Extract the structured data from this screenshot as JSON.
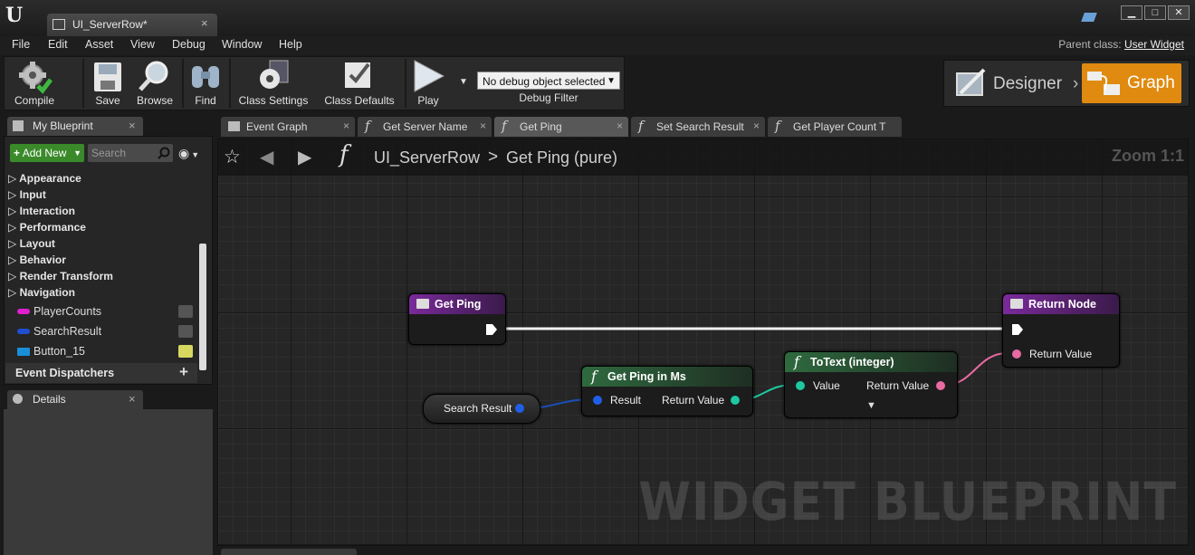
{
  "titlebar": {
    "doc_tab_label": "UI_ServerRow*",
    "doc_tab_close": "×",
    "win_min": "▁",
    "win_max": "□",
    "win_close": "✕"
  },
  "menu": {
    "items": [
      "File",
      "Edit",
      "Asset",
      "View",
      "Debug",
      "Window",
      "Help"
    ],
    "parent_class_label": "Parent class:",
    "parent_class_value": "User Widget"
  },
  "toolbar": {
    "compile": "Compile",
    "save": "Save",
    "browse": "Browse",
    "find": "Find",
    "class_settings": "Class Settings",
    "class_defaults": "Class Defaults",
    "play": "Play",
    "debug_select": "No debug object selected",
    "debug_filter": "Debug Filter"
  },
  "mode": {
    "designer": "Designer",
    "graph": "Graph",
    "accent": "#e08a10"
  },
  "my_blueprint": {
    "tab_label": "My Blueprint",
    "tab_close": "×",
    "add_new": "Add New",
    "search_placeholder": "Search",
    "categories": [
      "Appearance",
      "Input",
      "Interaction",
      "Performance",
      "Layout",
      "Behavior",
      "Render Transform",
      "Navigation"
    ],
    "variables": [
      {
        "name": "PlayerCounts",
        "color": "#e020d0"
      },
      {
        "name": "SearchResult",
        "color": "#1f4fd0"
      },
      {
        "name": "Button_15",
        "color": "#1a8fd8"
      }
    ],
    "event_dispatchers": "Event Dispatchers",
    "add_dispatcher": "+"
  },
  "details": {
    "tab_label": "Details",
    "tab_close": "×"
  },
  "graph_tabs": [
    {
      "label": "Event Graph",
      "close": "×"
    },
    {
      "label": "Get Server Name",
      "close": "×"
    },
    {
      "label": "Get Ping",
      "close": "×"
    },
    {
      "label": "Set Search Result",
      "close": "×"
    },
    {
      "label": "Get Player Count T",
      "close": ""
    }
  ],
  "graph": {
    "breadcrumb_app": "UI_ServerRow",
    "breadcrumb_sep": ">",
    "breadcrumb_func": "Get Ping (pure)",
    "zoom": "Zoom 1:1",
    "watermark": "WIDGET BLUEPRINT",
    "nodes": {
      "get_ping": {
        "title": "Get Ping"
      },
      "return_node": {
        "title": "Return Node",
        "pin_return": "Return Value"
      },
      "search_result": {
        "title": "Search Result"
      },
      "get_ping_ms": {
        "title": "Get Ping in Ms",
        "pin_in": "Result",
        "pin_out": "Return Value"
      },
      "totext": {
        "title": "ToText (integer)",
        "pin_in": "Value",
        "pin_out": "Return Value"
      }
    }
  }
}
